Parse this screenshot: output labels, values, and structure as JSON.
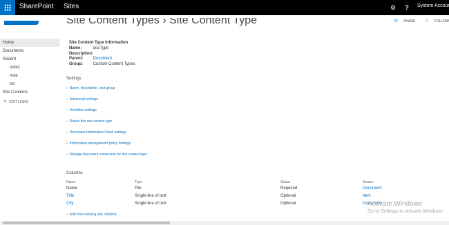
{
  "suite_bar": {
    "brand": "SharePoint",
    "sites": "Sites",
    "gear_icon": "gear-icon",
    "help": "?",
    "user": "System Account"
  },
  "action_bar": {
    "share": "SHARE",
    "follow": "FOLLOW"
  },
  "page": {
    "title": "Site Content Types › Site Content Type"
  },
  "nav": {
    "items": [
      {
        "label": "Home"
      },
      {
        "label": "Documents"
      },
      {
        "label": "Recent"
      },
      {
        "label": "note1"
      },
      {
        "label": "note"
      },
      {
        "label": "list"
      },
      {
        "label": "Site Contents"
      }
    ],
    "edit_links": "EDIT LINKS"
  },
  "info": {
    "heading": "Site Content Type Information",
    "rows": [
      {
        "label": "Name:",
        "value": "docType"
      },
      {
        "label": "Description:",
        "value": ""
      },
      {
        "label": "Parent:",
        "value": "Document"
      },
      {
        "label": "Group:",
        "value": "Custom Content Types"
      }
    ]
  },
  "settings": {
    "title": "Settings",
    "items": [
      "Name, description, and group",
      "Advanced settings",
      "Workflow settings",
      "Delete this site content type",
      "Document Information Panel settings",
      "Information management policy settings",
      "Manage document conversion for this content type"
    ]
  },
  "columns": {
    "title": "Columns",
    "headers": [
      "Name",
      "Type",
      "Status",
      "Source"
    ],
    "rows": [
      {
        "name": "Name",
        "type": "File",
        "status": "Required",
        "source": "Document"
      },
      {
        "name": "Title",
        "type": "Single line of text",
        "status": "Optional",
        "source": "Item"
      },
      {
        "name": "City",
        "type": "Single line of text",
        "status": "Optional",
        "source": "Document"
      }
    ],
    "add_existing": "Add from existing site columns"
  },
  "watermark": {
    "title": "Activate Windows",
    "subtitle": "Go to Settings to activate Windows."
  },
  "colors": {
    "accent": "#0072c6",
    "suite_bar": "#000000"
  }
}
